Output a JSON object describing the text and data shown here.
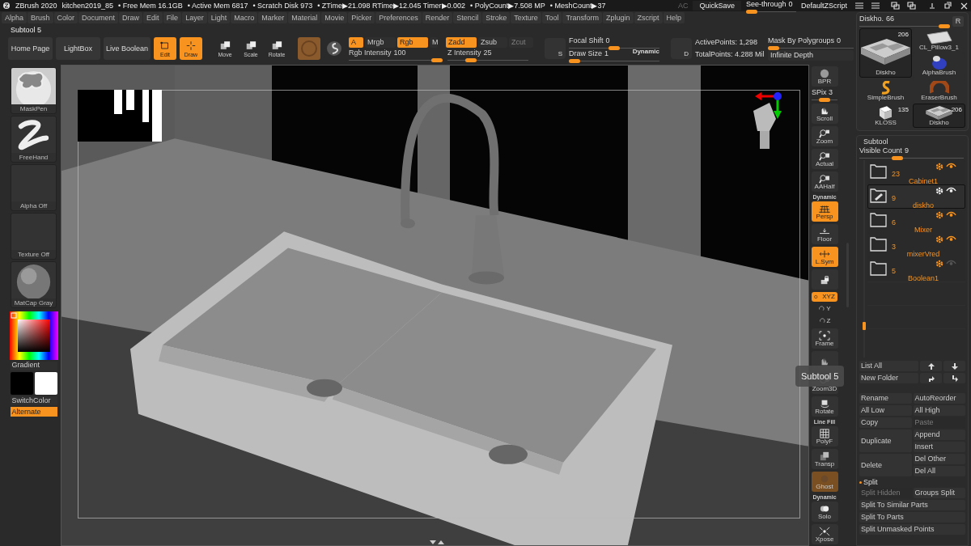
{
  "title_bar": {
    "app": "ZBrush 2020",
    "file": "kitchen2019_85",
    "stats": [
      "• Free Mem 16.1GB",
      "• Active Mem 6817",
      "• Scratch Disk 973",
      "• ZTime▶21.098 RTime▶12.045 Timer▶0.002",
      "• PolyCount▶7.508 MP",
      "• MeshCount▶37"
    ],
    "ac": "AC",
    "quicksave": "QuickSave",
    "see_through": {
      "label": "See-through",
      "value": "0",
      "level": 0
    },
    "script": "DefaultZScript"
  },
  "menu": [
    "Alpha",
    "Brush",
    "Color",
    "Document",
    "Draw",
    "Edit",
    "File",
    "Layer",
    "Light",
    "Macro",
    "Marker",
    "Material",
    "Movie",
    "Picker",
    "Preferences",
    "Render",
    "Stencil",
    "Stroke",
    "Texture",
    "Tool",
    "Transform",
    "Zplugin",
    "Zscript",
    "Help"
  ],
  "toolbar": {
    "subtool_label": "Subtool 5",
    "nav_buttons": [
      "Home Page",
      "LightBox",
      "Live Boolean"
    ],
    "modes": [
      {
        "label": "Edit",
        "kind": "edit",
        "selected": true
      },
      {
        "label": "Draw",
        "kind": "draw",
        "selected": true
      },
      {
        "label": "Move",
        "kind": "move",
        "selected": false
      },
      {
        "label": "Scale",
        "kind": "scale",
        "selected": false
      },
      {
        "label": "Rotate",
        "kind": "rotate",
        "selected": false
      }
    ],
    "toggles": [
      {
        "label": "A",
        "on": true,
        "disabled": false
      },
      {
        "label": "Mrgb",
        "on": false,
        "disabled": false
      },
      {
        "label": "Rgb",
        "on": true,
        "disabled": false
      },
      {
        "label": "M",
        "on": false,
        "disabled": false
      },
      {
        "label": "Zadd",
        "on": true,
        "disabled": false
      },
      {
        "label": "Zsub",
        "on": false,
        "disabled": false
      },
      {
        "label": "Zcut",
        "on": false,
        "disabled": true
      }
    ],
    "rgb_intensity": {
      "label": "Rgb Intensity",
      "value": "100",
      "level": 1
    },
    "z_intensity": {
      "label": "Z Intensity",
      "value": "25",
      "level": 0.25
    },
    "s_icon": "S",
    "focal_shift": {
      "label": "Focal Shift",
      "value": "0",
      "level": 0.5
    },
    "draw_size": {
      "label": "Draw Size",
      "value": "1",
      "level": 0
    },
    "dynamic": "Dynamic",
    "d_icon": "D",
    "active_points": "ActivePoints: 1,298",
    "total_points": "TotalPoints: 4.288 Mil",
    "mask_by_polygroups": {
      "label": "Mask By Polygroups",
      "value": "0",
      "level": 0
    },
    "infinite_depth": "Infinite Depth"
  },
  "left_shelf": {
    "tiles": [
      {
        "label": "MaskPen",
        "kind": "brush"
      },
      {
        "label": "FreeHand",
        "kind": "stroke"
      },
      {
        "label": "Alpha Off",
        "kind": "empty"
      },
      {
        "label": "Texture Off",
        "kind": "empty"
      },
      {
        "label": "MatCap Gray",
        "kind": "material"
      }
    ],
    "gradient": "Gradient",
    "switch_color": "SwitchColor",
    "alternate": {
      "label": "Alternate",
      "on": true
    }
  },
  "viewport": {
    "tooltip": "Subtool 5"
  },
  "right_shelf": [
    {
      "kind": "render",
      "label": "BPR",
      "on": false
    },
    {
      "kind": "slider",
      "label": "SPix 3",
      "level": 0.5
    },
    {
      "kind": "scroll",
      "label": "Scroll",
      "on": false
    },
    {
      "kind": "zoom",
      "label": "Zoom",
      "on": false
    },
    {
      "kind": "actual",
      "label": "Actual",
      "on": false
    },
    {
      "kind": "aahalf",
      "label": "AAHalf",
      "on": false
    },
    {
      "kind": "persp",
      "label": "Persp",
      "caption": "Dynamic",
      "on": true
    },
    {
      "kind": "floor",
      "label": "Floor",
      "on": false
    },
    {
      "kind": "symmetry",
      "label": "L.Sym",
      "on": true
    },
    {
      "kind": "lock",
      "on": false
    },
    {
      "kind": "xyz",
      "label": "XYZ",
      "on": true
    },
    {
      "kind": "axis",
      "label": "Y"
    },
    {
      "kind": "axis",
      "label": "Z"
    },
    {
      "kind": "frame",
      "label": "Frame",
      "on": false
    },
    {
      "kind": "move",
      "on": false
    },
    {
      "kind": "zoom3d",
      "label": "Zoom3D",
      "on": false
    },
    {
      "kind": "rotate",
      "label": "Rotate",
      "on": false
    },
    {
      "kind": "polyf",
      "label": "PolyF",
      "caption": "Line Fill",
      "on": false
    },
    {
      "kind": "transp",
      "label": "Transp",
      "on": false
    },
    {
      "kind": "ghost",
      "label": "Ghost",
      "on": true
    },
    {
      "kind": "solo",
      "label": "Solo",
      "caption": "Dynamic",
      "on": false
    },
    {
      "kind": "xpose",
      "label": "Xpose",
      "on": false
    }
  ],
  "tool_palette": {
    "slider": {
      "label": "Diskho.",
      "value": "66",
      "level": 1
    },
    "r_button": "R",
    "tiles": [
      {
        "label": "Diskho",
        "count": "206",
        "kind": "sink",
        "selected": true
      },
      {
        "label": "CL_Pillow3_1",
        "kind": "pillow",
        "selected": false
      },
      {
        "label": "AlphaBrush",
        "kind": "alphabrush",
        "selected": false
      },
      {
        "label": "SimpleBrush",
        "kind": "simplebrush",
        "selected": false
      },
      {
        "label": "EraserBrush",
        "kind": "eraser",
        "selected": false
      },
      {
        "label": "KLOSS",
        "count": "135",
        "kind": "cube",
        "selected": false
      },
      {
        "label": "Diskho",
        "count": "206",
        "kind": "sink",
        "selected": true
      }
    ]
  },
  "subtool": {
    "title": "Subtool",
    "visible_count": {
      "label": "Visible Count",
      "value": "9",
      "level": 0.35
    },
    "items": [
      {
        "count": "23",
        "name": "Cabinet1",
        "selected": false,
        "visible": true
      },
      {
        "count": "9",
        "name": "diskho",
        "selected": true,
        "visible": true
      },
      {
        "count": "6",
        "name": "Mixer",
        "selected": false,
        "visible": true
      },
      {
        "count": "3",
        "name": "mixerVred",
        "selected": false,
        "visible": true
      },
      {
        "count": "5",
        "name": "Boolean1",
        "selected": false,
        "visible": false
      }
    ],
    "list_all": "List All",
    "new_folder": "New Folder",
    "actions": [
      {
        "label": "Rename",
        "disabled": false
      },
      {
        "label": "AutoReorder",
        "disabled": false
      },
      {
        "label": "All Low",
        "disabled": false
      },
      {
        "label": "All High",
        "disabled": false
      },
      {
        "label": "Copy",
        "disabled": false
      },
      {
        "label": "Paste",
        "disabled": true
      }
    ],
    "duplicate": "Duplicate",
    "append": "Append",
    "insert": "Insert",
    "delete": "Delete",
    "del_other": "Del Other",
    "del_all": "Del All",
    "split": {
      "title": "Split",
      "buttons": [
        {
          "label": "Split Hidden",
          "disabled": true
        },
        {
          "label": "Groups Split",
          "disabled": false
        },
        {
          "label": "Split To Similar Parts",
          "disabled": false
        },
        {
          "label": "Split To Parts",
          "disabled": false
        },
        {
          "label": "Split Unmasked Points",
          "disabled": false
        }
      ]
    }
  }
}
